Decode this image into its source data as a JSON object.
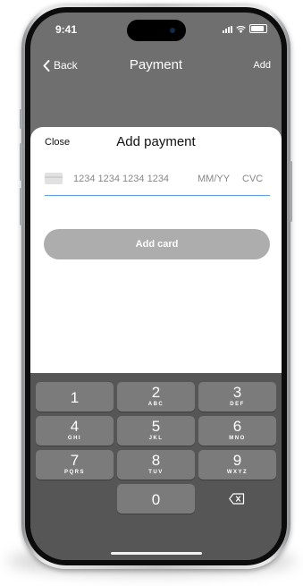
{
  "status_bar": {
    "time": "9:41"
  },
  "nav": {
    "back_label": "Back",
    "title": "Payment",
    "add_label": "Add"
  },
  "sheet": {
    "close_label": "Close",
    "title": "Add payment",
    "card_number_placeholder": "1234 1234 1234 1234",
    "expiry_placeholder": "MM/YY",
    "cvc_placeholder": "CVC",
    "add_card_label": "Add card"
  },
  "keyboard": {
    "keys": [
      {
        "num": "1",
        "letters": ""
      },
      {
        "num": "2",
        "letters": "ABC"
      },
      {
        "num": "3",
        "letters": "DEF"
      },
      {
        "num": "4",
        "letters": "GHI"
      },
      {
        "num": "5",
        "letters": "JKL"
      },
      {
        "num": "6",
        "letters": "MNO"
      },
      {
        "num": "7",
        "letters": "PQRS"
      },
      {
        "num": "8",
        "letters": "TUV"
      },
      {
        "num": "9",
        "letters": "WXYZ"
      },
      {
        "num": "0",
        "letters": ""
      }
    ]
  },
  "colors": {
    "accent": "#5aa1e6",
    "disabled_button": "#adadad",
    "keyboard_background": "#565657",
    "key": "#7b7b7c",
    "dimmed_backdrop": "#6f6f70"
  }
}
